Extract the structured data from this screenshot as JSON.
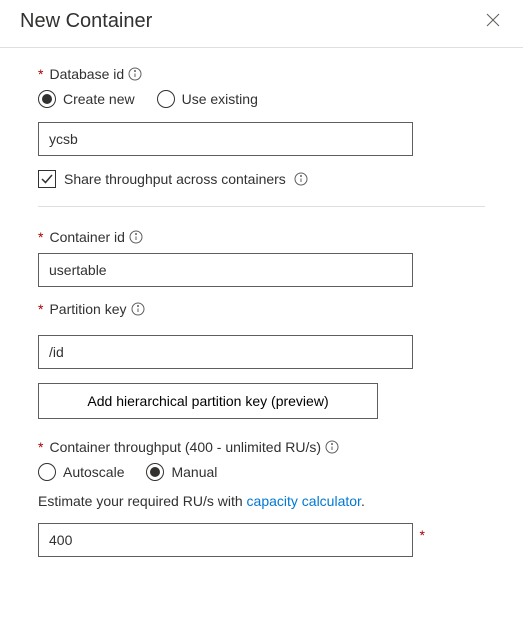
{
  "header": {
    "title": "New Container"
  },
  "database": {
    "label": "Database id",
    "radio_create": "Create new",
    "radio_existing": "Use existing",
    "value": "ycsb",
    "share_label": "Share throughput across containers"
  },
  "container": {
    "label": "Container id",
    "value": "usertable"
  },
  "partition": {
    "label": "Partition key",
    "value": "/id",
    "hierarchical_btn": "Add hierarchical partition key (preview)"
  },
  "throughput": {
    "label": "Container throughput (400 - unlimited RU/s)",
    "radio_autoscale": "Autoscale",
    "radio_manual": "Manual",
    "hint_prefix": "Estimate your required RU/s with ",
    "hint_link": "capacity calculator",
    "hint_suffix": ".",
    "value": "400"
  }
}
